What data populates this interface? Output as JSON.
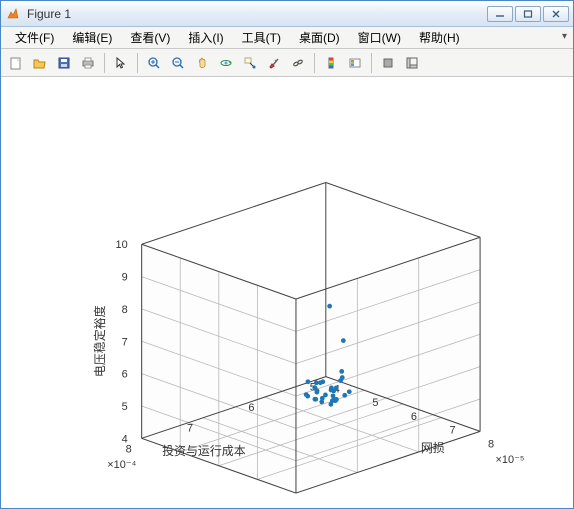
{
  "window": {
    "title": "Figure 1"
  },
  "menu": {
    "file": "文件(F)",
    "edit": "编辑(E)",
    "view": "查看(V)",
    "insert": "插入(I)",
    "tools": "工具(T)",
    "desktop": "桌面(D)",
    "window": "窗口(W)",
    "help": "帮助(H)"
  },
  "toolbar_icons": {
    "new": "new-figure-icon",
    "open": "open-icon",
    "save": "save-icon",
    "print": "print-icon",
    "pointer": "pointer-icon",
    "zoom_in": "zoom-in-icon",
    "zoom_out": "zoom-out-icon",
    "pan": "pan-icon",
    "rotate": "rotate3d-icon",
    "datacursor": "data-cursor-icon",
    "brush": "brush-icon",
    "link": "link-icon",
    "colorbar": "colorbar-icon",
    "legend": "legend-icon",
    "hide_tools": "hide-plot-tools-icon",
    "show_tools": "show-plot-tools-icon"
  },
  "chart_data": {
    "type": "scatter",
    "dimensions": 3,
    "xlabel": "网损",
    "ylabel": "投资与运行成本",
    "zlabel": "电压稳定裕度",
    "x_scale_label": "×10⁻⁵",
    "y_scale_label": "×10⁻⁴",
    "x_range": [
      4,
      8
    ],
    "y_range": [
      5,
      8
    ],
    "z_range": [
      4,
      10
    ],
    "x_ticks": [
      4,
      5,
      6,
      7,
      8
    ],
    "y_ticks": [
      5,
      6,
      7,
      8
    ],
    "z_ticks": [
      4,
      5,
      6,
      7,
      8,
      9,
      10
    ],
    "series": [
      {
        "name": "points",
        "color": "#1f77b4",
        "x": [
          4.4,
          4.7,
          5.0,
          5.1,
          5.2,
          5.3,
          5.4,
          5.5,
          5.6,
          5.6,
          5.7,
          5.8,
          5.9,
          6.0,
          6.0,
          6.1,
          6.2,
          6.2,
          6.3,
          6.4,
          6.4,
          6.5,
          6.6,
          6.8,
          6.9,
          7.0,
          7.0,
          7.2,
          7.3,
          7.4,
          7.6,
          7.7
        ],
        "y": [
          5.3,
          5.2,
          5.5,
          5.6,
          5.9,
          5.7,
          6.2,
          6.0,
          5.9,
          6.3,
          5.8,
          6.0,
          6.2,
          6.4,
          6.1,
          6.5,
          6.0,
          6.3,
          6.6,
          6.2,
          6.8,
          6.4,
          6.7,
          6.5,
          7.0,
          6.8,
          6.6,
          7.1,
          6.9,
          7.3,
          7.2,
          7.5
        ],
        "z": [
          4.2,
          4.3,
          4.3,
          4.5,
          4.6,
          4.4,
          4.8,
          4.6,
          4.5,
          4.9,
          5.2,
          4.7,
          5.0,
          5.3,
          4.8,
          5.5,
          5.1,
          4.9,
          5.8,
          5.2,
          6.0,
          5.6,
          5.4,
          6.3,
          5.8,
          6.0,
          7.4,
          6.5,
          5.9,
          6.2,
          9.1,
          6.8
        ]
      }
    ],
    "grid": true
  }
}
